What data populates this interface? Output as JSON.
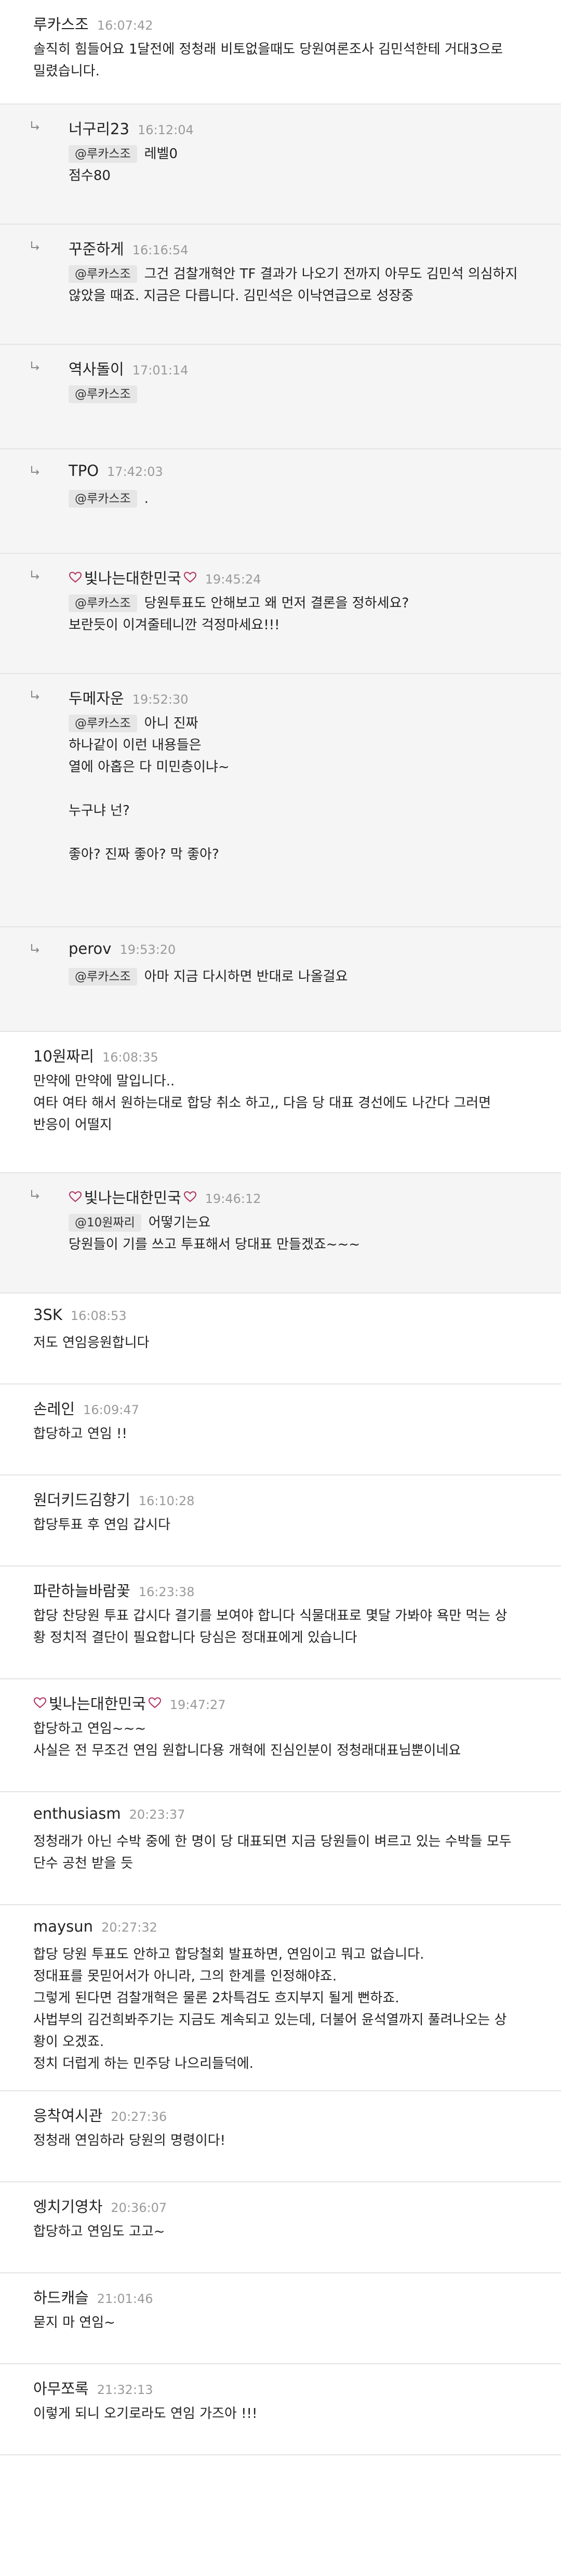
{
  "comments": [
    {
      "author": "루카스조",
      "heart": false,
      "time": "16:07:42",
      "reply": false,
      "mention": "",
      "lines": [
        "솔직히 힘들어요 1달전에 정청래 비토없을때도 당원여론조사 김민석한테 거대3으로",
        "밀렸습니다."
      ]
    },
    {
      "author": "너구리23",
      "heart": false,
      "time": "16:12:04",
      "reply": true,
      "mention": "@루카스조",
      "lines": [
        "레벨0",
        "점수80"
      ]
    },
    {
      "author": "꾸준하게",
      "heart": false,
      "time": "16:16:54",
      "reply": true,
      "mention": "@루카스조",
      "lines": [
        "그건 검찰개혁안 TF 결과가 나오기 전까지 아무도 김민석 의심하지",
        "않았을 때죠. 지금은 다릅니다. 김민석은 이낙연급으로 성장중"
      ]
    },
    {
      "author": "역사돌이",
      "heart": false,
      "time": "17:01:14",
      "reply": true,
      "mention": "@루카스조",
      "lines": [
        ""
      ]
    },
    {
      "author": "TPO",
      "heart": false,
      "time": "17:42:03",
      "reply": true,
      "mention": "@루카스조",
      "lines": [
        "."
      ]
    },
    {
      "author": "빛나는대한민국",
      "heart": true,
      "time": "19:45:24",
      "reply": true,
      "mention": "@루카스조",
      "lines": [
        "당원투표도 안해보고 왜 먼저 결론을 정하세요?",
        "보란듯이 이겨줄테니깐 걱정마세요!!!"
      ]
    },
    {
      "author": "두메자운",
      "heart": false,
      "time": "19:52:30",
      "reply": true,
      "mention": "@루카스조",
      "lines": [
        "아니 진짜",
        "하나같이 이런 내용들은",
        "열에 아홉은 다 미민층이냐~",
        "",
        "누구냐 넌?",
        "",
        "좋아? 진짜 좋아? 막 좋아?"
      ]
    },
    {
      "author": "perov",
      "heart": false,
      "time": "19:53:20",
      "reply": true,
      "mention": "@루카스조",
      "lines": [
        "아마 지금 다시하면 반대로 나올걸요"
      ]
    },
    {
      "author": "10원짜리",
      "heart": false,
      "time": "16:08:35",
      "reply": false,
      "mention": "",
      "lines": [
        "만약에 만약에 말입니다..",
        "여타 여타 해서 원하는대로 합당 취소 하고,, 다음 당 대표 경선에도 나간다 그러면",
        "반응이 어떨지"
      ]
    },
    {
      "author": "빛나는대한민국",
      "heart": true,
      "time": "19:46:12",
      "reply": true,
      "mention": "@10원짜리",
      "lines": [
        "어떻기는요",
        "당원들이 기를 쓰고 투표해서 당대표 만들겠죠~~~"
      ]
    },
    {
      "author": "3SK",
      "heart": false,
      "time": "16:08:53",
      "reply": false,
      "mention": "",
      "lines": [
        "저도 연임응원합니다"
      ]
    },
    {
      "author": "손레인",
      "heart": false,
      "time": "16:09:47",
      "reply": false,
      "mention": "",
      "lines": [
        "합당하고 연임 !!"
      ]
    },
    {
      "author": "원더키드김향기",
      "heart": false,
      "time": "16:10:28",
      "reply": false,
      "mention": "",
      "lines": [
        "합당투표 후 연임 갑시다"
      ]
    },
    {
      "author": "파란하늘바람꽃",
      "heart": false,
      "time": "16:23:38",
      "reply": false,
      "mention": "",
      "lines": [
        "합당 찬당원 투표 갑시다 결기를 보여야 합니다 식물대표로 몇달 가봐야 욕만 먹는 상",
        "황 정치적 결단이 필요합니다 당심은 정대표에게 있습니다"
      ]
    },
    {
      "author": "빛나는대한민국",
      "heart": true,
      "time": "19:47:27",
      "reply": false,
      "mention": "",
      "lines": [
        "합당하고 연임~~~",
        "사실은 전 무조건 연임 원합니다용 개혁에 진심인분이 정청래대표님뿐이네요"
      ]
    },
    {
      "author": "enthusiasm",
      "heart": false,
      "time": "20:23:37",
      "reply": false,
      "mention": "",
      "lines": [
        "정청래가 아닌 수박 중에 한 명이 당 대표되면 지금 당원들이 벼르고 있는 수박들 모두",
        "단수 공천 받을 듯"
      ]
    },
    {
      "author": "maysun",
      "heart": false,
      "time": "20:27:32",
      "reply": false,
      "mention": "",
      "lines": [
        "합당 당원 투표도 안하고 합당철회 발표하면, 연임이고 뭐고 없습니다.",
        "정대표를 못믿어서가 아니라, 그의 한계를 인정해야죠.",
        "그렇게 된다면 검찰개혁은 물론 2차특검도 흐지부지 될게 뻔하죠.",
        "사법부의 김건희봐주기는 지금도 계속되고 있는데, 더불어 윤석열까지 풀려나오는 상",
        "황이 오겠죠.",
        "정치 더럽게 하는 민주당 나으리들덕에."
      ]
    },
    {
      "author": "응착여시관",
      "heart": false,
      "time": "20:27:36",
      "reply": false,
      "mention": "",
      "lines": [
        "정청래 연임하라 당원의 명령이다!"
      ]
    },
    {
      "author": "엥치기영차",
      "heart": false,
      "time": "20:36:07",
      "reply": false,
      "mention": "",
      "lines": [
        "합당하고 연임도 고고~"
      ]
    },
    {
      "author": "하드캐슬",
      "heart": false,
      "time": "21:01:46",
      "reply": false,
      "mention": "",
      "lines": [
        "묻지 마 연임~"
      ]
    },
    {
      "author": "아무쪼록",
      "heart": false,
      "time": "21:32:13",
      "reply": false,
      "mention": "",
      "lines": [
        "이렇게 되니 오기로라도 연임 가즈아 !!!"
      ]
    }
  ]
}
